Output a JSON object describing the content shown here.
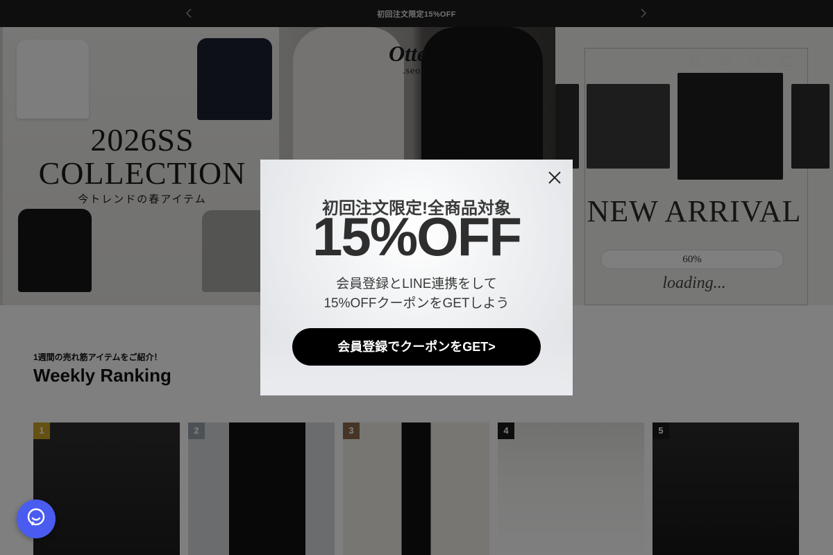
{
  "announcement": {
    "text": "初回注文限定15%OFF",
    "prev_icon": "chevron-left-icon",
    "next_icon": "chevron-right-icon"
  },
  "hero": {
    "collection": {
      "title_line1": "2026SS",
      "title_line2": "COLLECTION",
      "subtitle": "今トレンドの春アイテム"
    },
    "brand": {
      "logo_main": "Otte",
      "logo_sub": ".seoul"
    },
    "new_arrival": {
      "title": "NEW ARRIVAL",
      "progress_text": "60%",
      "progress": 0.6,
      "loading_text": "loading..."
    }
  },
  "header_icons": [
    "account-icon",
    "wishlist-heart-icon",
    "search-icon",
    "cart-bag-icon"
  ],
  "ranking": {
    "subtitle": "1週間の売れ筋アイテムをご紹介！",
    "title": "Weekly Ranking",
    "items": [
      {
        "rank": "1",
        "badge_color": "#c9a227"
      },
      {
        "rank": "2",
        "badge_color": "#9aa3ad"
      },
      {
        "rank": "3",
        "badge_color": "#8c6a4f"
      },
      {
        "rank": "4",
        "badge_color": "#1a1a1a"
      },
      {
        "rank": "5",
        "badge_color": "#1a1a1a"
      }
    ]
  },
  "popup": {
    "headline": "初回注文限定!全商品対象",
    "discount": "15%OFF",
    "body_line1": "会員登録とLINE連携をして",
    "body_line2": "15%OFFクーポンをGETしよう",
    "cta_label": "会員登録でクーポンをGET>",
    "close_icon": "close-icon"
  },
  "chat": {
    "icon": "chat-bubble-icon",
    "color": "#4a5cf0"
  }
}
